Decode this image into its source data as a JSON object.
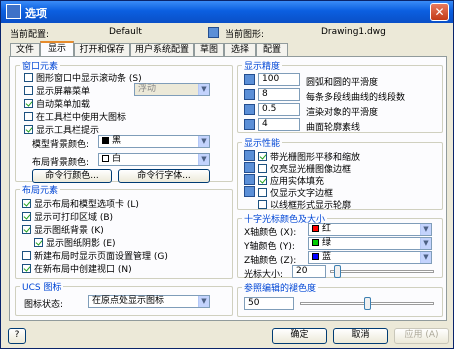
{
  "window": {
    "title": "选项",
    "close_glyph": "✕"
  },
  "header": {
    "profile_label": "当前配置:",
    "profile_value": "Default",
    "drawing_label": "当前图形:",
    "drawing_value": "Drawing1.dwg"
  },
  "tabs": [
    "文件",
    "显示",
    "打开和保存",
    "用户系统配置",
    "草图",
    "选择",
    "配置"
  ],
  "window_elements": {
    "legend": "窗口元素",
    "items": [
      {
        "label": "图形窗口中显示滚动条 (S)",
        "checked": false
      },
      {
        "label": "显示屏幕菜单",
        "checked": false
      },
      {
        "label": "自动菜单加载",
        "checked": true
      },
      {
        "label": "在工具栏中使用大图标",
        "checked": false
      },
      {
        "label": "显示工具栏提示",
        "checked": true
      }
    ],
    "float_value": "浮动",
    "model_bg_label": "模型背景颜色:",
    "model_bg_value": "黑",
    "layout_bg_label": "布局背景颜色:",
    "layout_bg_value": "白",
    "cmd_color_btn": "命令行颜色...",
    "cmd_font_btn": "命令行字体..."
  },
  "layout_elements": {
    "legend": "布局元素",
    "items": [
      {
        "label": "显示布局和模型选项卡 (L)",
        "checked": true
      },
      {
        "label": "显示可打印区域 (B)",
        "checked": true
      },
      {
        "label": "显示图纸背景 (K)",
        "checked": true
      },
      {
        "label": "显示图纸阴影 (E)",
        "checked": true
      },
      {
        "label": "新建布局时显示页面设置管理 (G)",
        "checked": false
      },
      {
        "label": "在新布局中创建视口 (N)",
        "checked": true
      }
    ]
  },
  "ucs": {
    "legend": "UCS 图标",
    "label": "图标状态:",
    "value": "在原点处显示图标"
  },
  "precision": {
    "legend": "显示精度",
    "items": [
      {
        "value": "100",
        "label": "圆弧和圆的平滑度"
      },
      {
        "value": "8",
        "label": "每条多段线曲线的线段数"
      },
      {
        "value": "0.5",
        "label": "渲染对象的平滑度"
      },
      {
        "value": "4",
        "label": "曲面轮廓素线"
      }
    ]
  },
  "performance": {
    "legend": "显示性能",
    "items": [
      {
        "label": "带光栅图形平移和缩放",
        "checked": true
      },
      {
        "label": "仅亮显光栅图像边框",
        "checked": false
      },
      {
        "label": "应用实体填充",
        "checked": true
      },
      {
        "label": "仅显示文字边框",
        "checked": false
      },
      {
        "label": "以线框形式显示轮廓",
        "checked": false
      }
    ]
  },
  "crosshair": {
    "legend": "十字光标颜色及大小",
    "axes": [
      {
        "label": "X轴颜色 (X):",
        "value": "红",
        "color": "#ff0000"
      },
      {
        "label": "Y轴颜色 (Y):",
        "value": "绿",
        "color": "#00cc00"
      },
      {
        "label": "Z轴颜色 (Z):",
        "value": "蓝",
        "color": "#0000ff"
      }
    ],
    "size_label": "光标大小:",
    "size_value": "20"
  },
  "xref_fade": {
    "legend": "参照编辑的褪色度",
    "value": "50"
  },
  "buttons": {
    "help": "?",
    "ok": "确定",
    "cancel": "取消",
    "apply": "应用 (A)"
  }
}
